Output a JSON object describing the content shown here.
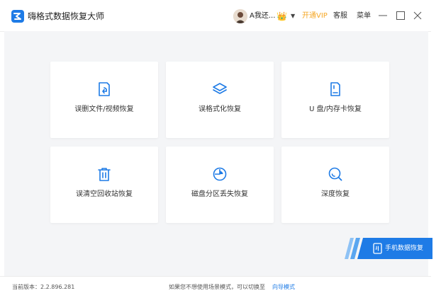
{
  "app": {
    "title": "嗨格式数据恢复大师"
  },
  "header": {
    "username": "A我还...",
    "vip_label": "开通VIP",
    "service_label": "客服",
    "menu_label": "菜单"
  },
  "cards": [
    {
      "label": "误删文件/视频恢复",
      "icon": "file-restore-icon"
    },
    {
      "label": "误格式化恢复",
      "icon": "layers-icon"
    },
    {
      "label": "U 盘/内存卡恢复",
      "icon": "sd-card-icon"
    },
    {
      "label": "误清空回收站恢复",
      "icon": "trash-icon"
    },
    {
      "label": "磁盘分区丢失恢复",
      "icon": "pie-chart-icon"
    },
    {
      "label": "深度恢复",
      "icon": "deep-search-icon"
    }
  ],
  "phone_recovery": {
    "label": "手机数据恢复"
  },
  "footer": {
    "version": "当前版本：2.2.896.281",
    "hint": "如果您不想使用场景模式，可以切换至",
    "guide_link": "向导模式"
  },
  "colors": {
    "accent": "#1e7be6",
    "vip": "#f5a623",
    "background": "#f4f5f7"
  }
}
